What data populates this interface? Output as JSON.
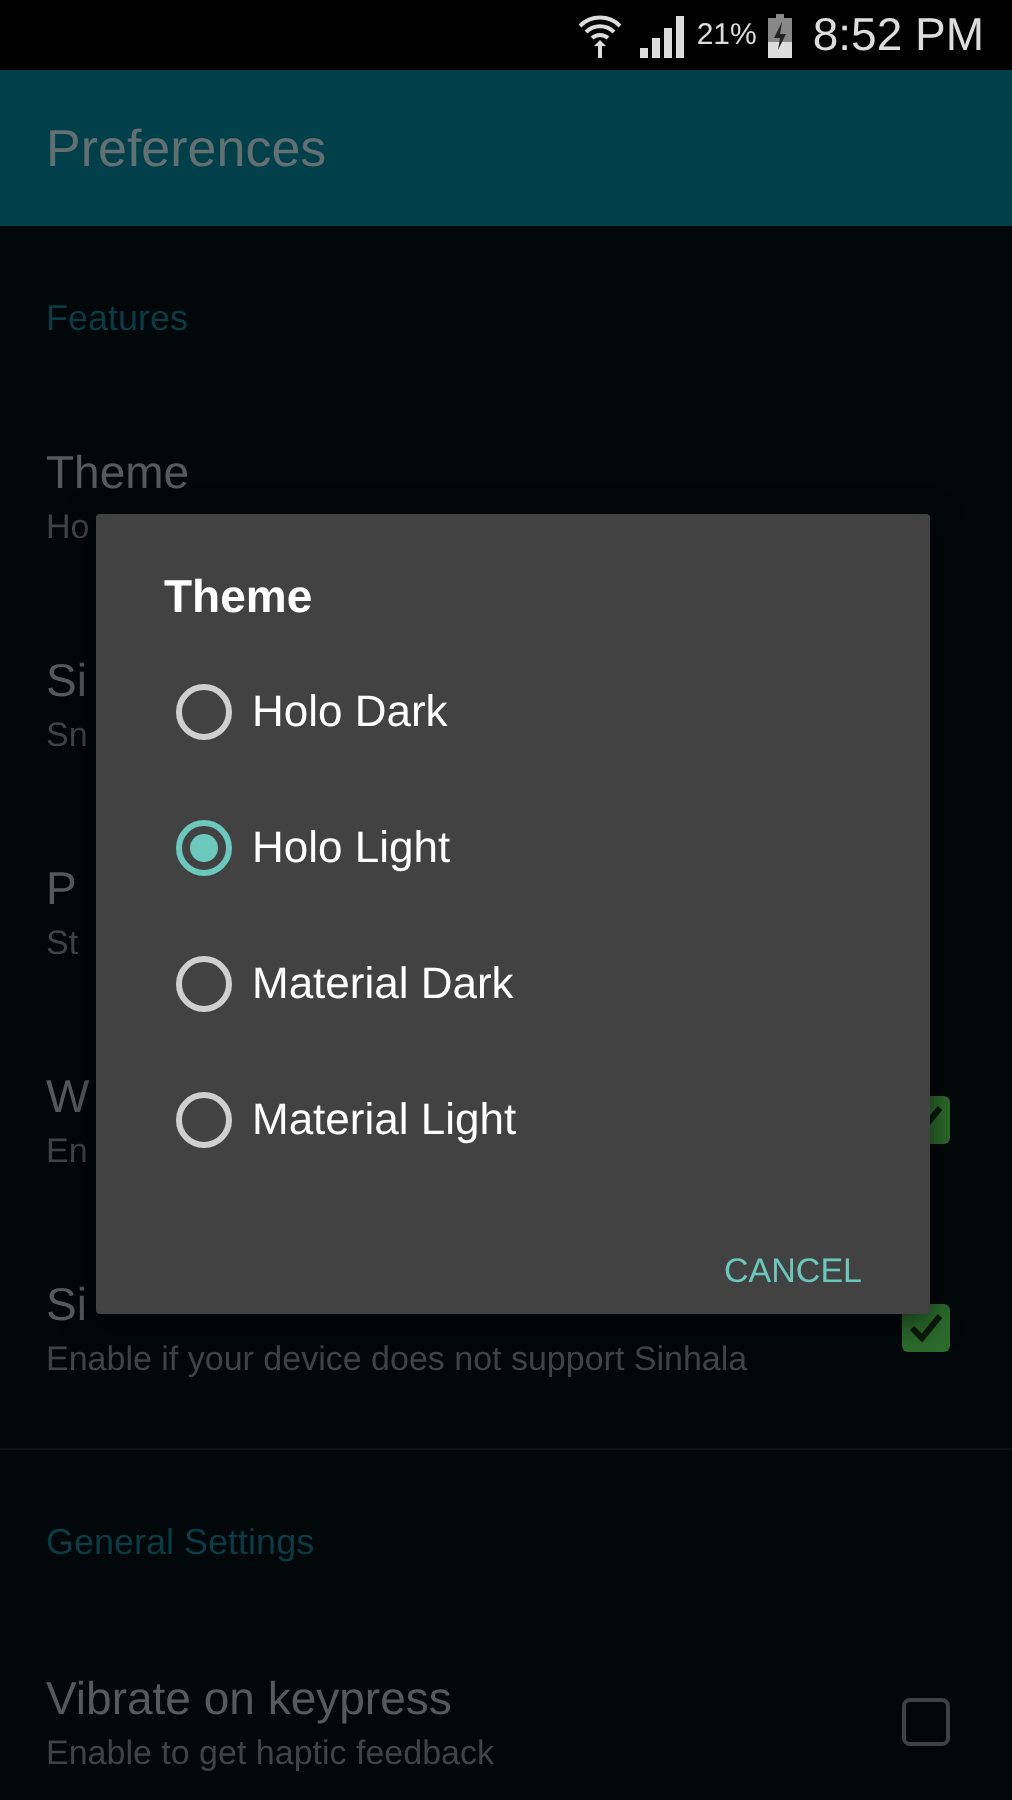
{
  "status_bar": {
    "battery_percent": "21%",
    "time": "8:52 PM"
  },
  "app_bar": {
    "title": "Preferences"
  },
  "sections": [
    {
      "header": "Features",
      "items": [
        {
          "kind": "plain",
          "title": "Theme",
          "summary": "Ho"
        },
        {
          "kind": "plain",
          "title": "Si",
          "summary": "Sn"
        },
        {
          "kind": "plain",
          "title": "P",
          "summary": "St"
        },
        {
          "kind": "checkbox",
          "title": "W",
          "summary": "En",
          "checked": true
        },
        {
          "kind": "checkbox",
          "title": "Si",
          "summary": "Enable if your device does not support Sinhala",
          "checked": true
        }
      ]
    },
    {
      "header": "General Settings",
      "items": [
        {
          "kind": "checkbox",
          "title": "Vibrate on keypress",
          "summary": "Enable to get haptic feedback",
          "checked": false
        }
      ]
    }
  ],
  "dialog": {
    "title": "Theme",
    "options": [
      {
        "label": "Holo Dark",
        "selected": false
      },
      {
        "label": "Holo Light",
        "selected": true
      },
      {
        "label": "Material Dark",
        "selected": false
      },
      {
        "label": "Material Light",
        "selected": false
      }
    ],
    "button": "CANCEL"
  }
}
